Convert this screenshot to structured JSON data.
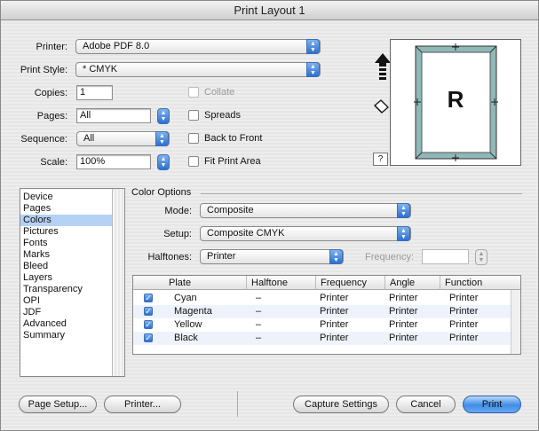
{
  "window": {
    "title": "Print Layout 1"
  },
  "top": {
    "printer_label": "Printer:",
    "printer_value": "Adobe PDF 8.0",
    "style_label": "Print Style:",
    "style_value": "* CMYK",
    "copies_label": "Copies:",
    "copies_value": "1",
    "pages_label": "Pages:",
    "pages_value": "All",
    "sequence_label": "Sequence:",
    "sequence_value": "All",
    "scale_label": "Scale:",
    "scale_value": "100%",
    "collate_label": "Collate",
    "spreads_label": "Spreads",
    "back_to_front_label": "Back to Front",
    "fit_print_area_label": "Fit Print Area"
  },
  "preview": {
    "page_letter": "R",
    "help_label": "?"
  },
  "sidebar": {
    "items": [
      {
        "label": "Device"
      },
      {
        "label": "Pages"
      },
      {
        "label": "Colors",
        "selected": true
      },
      {
        "label": "Pictures"
      },
      {
        "label": "Fonts"
      },
      {
        "label": "Marks"
      },
      {
        "label": "Bleed"
      },
      {
        "label": "Layers"
      },
      {
        "label": "Transparency"
      },
      {
        "label": "OPI"
      },
      {
        "label": "JDF"
      },
      {
        "label": "Advanced"
      },
      {
        "label": "Summary"
      }
    ]
  },
  "color_options": {
    "section_title": "Color Options",
    "mode_label": "Mode:",
    "mode_value": "Composite",
    "setup_label": "Setup:",
    "setup_value": "Composite CMYK",
    "halftones_label": "Halftones:",
    "halftones_value": "Printer",
    "frequency_label": "Frequency:",
    "frequency_value": ""
  },
  "table": {
    "columns": [
      "Plate",
      "Halftone",
      "Frequency",
      "Angle",
      "Function"
    ],
    "rows": [
      {
        "plate": "Cyan",
        "halftone": "–",
        "frequency": "Printer",
        "angle": "Printer",
        "function": "Printer"
      },
      {
        "plate": "Magenta",
        "halftone": "–",
        "frequency": "Printer",
        "angle": "Printer",
        "function": "Printer"
      },
      {
        "plate": "Yellow",
        "halftone": "–",
        "frequency": "Printer",
        "angle": "Printer",
        "function": "Printer"
      },
      {
        "plate": "Black",
        "halftone": "–",
        "frequency": "Printer",
        "angle": "Printer",
        "function": "Printer"
      }
    ]
  },
  "buttons": {
    "page_setup": "Page Setup...",
    "printer": "Printer...",
    "capture_settings": "Capture Settings",
    "cancel": "Cancel",
    "print": "Print"
  },
  "colors": {
    "accent": "#3f8de8",
    "selection": "#b5d2f5",
    "row_alt": "#eef3fb",
    "page_frame": "#8fb8b8"
  }
}
